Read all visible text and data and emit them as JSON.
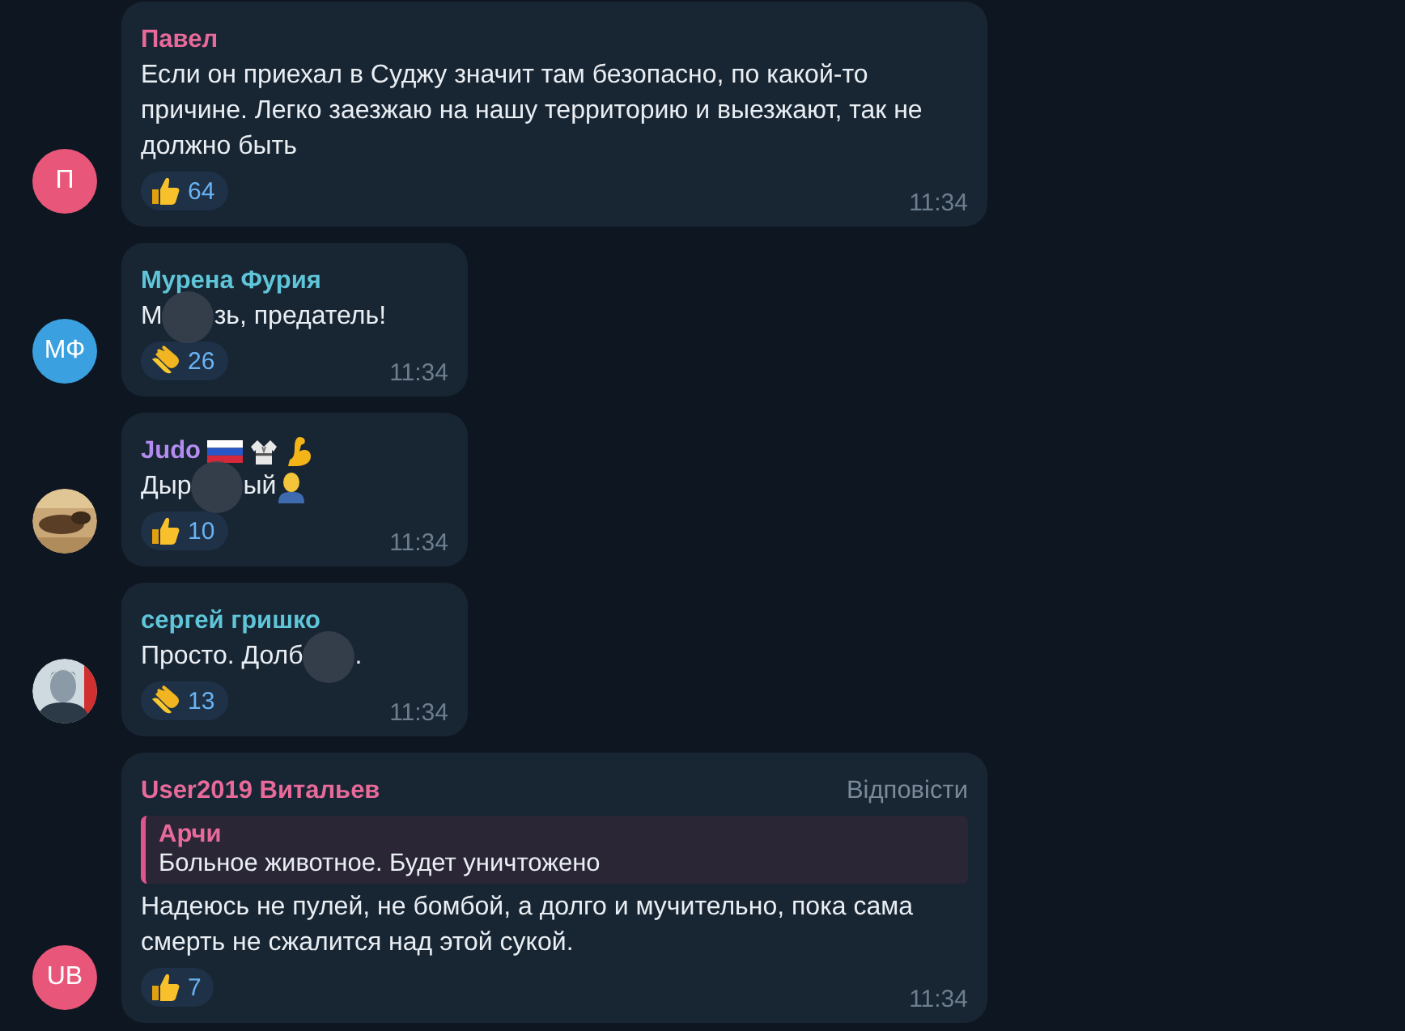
{
  "messages": [
    {
      "author": {
        "name": "Павел",
        "color": "#e86a9a"
      },
      "avatar": {
        "kind": "initials",
        "initials": "П",
        "color": "#e8577a"
      },
      "text": [
        {
          "kind": "text",
          "text": "Если он приехал в Суджу значит там безопасно, по какой-то причине. Легко заезжаю на нашу территорию и выезжают, так не должно быть"
        }
      ],
      "reaction": {
        "kind": "thumbs_up",
        "count": "64"
      },
      "time": "11:34"
    },
    {
      "author": {
        "name": "Мурена Фурия",
        "color": "#5fc5d8"
      },
      "avatar": {
        "kind": "initials",
        "initials": "МФ",
        "color": "#3aa0e0"
      },
      "text": [
        {
          "kind": "text",
          "text": "М"
        },
        {
          "kind": "blur"
        },
        {
          "kind": "text",
          "text": "зь, предатель!"
        }
      ],
      "reaction": {
        "kind": "clap",
        "count": "26"
      },
      "time": "11:34"
    },
    {
      "author": {
        "name": "Judo",
        "color": "#b48cf0",
        "icons": [
          {
            "kind": "flag"
          },
          {
            "kind": "kimono"
          },
          {
            "kind": "muscle"
          }
        ]
      },
      "avatar": {
        "kind": "picture"
      },
      "text": [
        {
          "kind": "text",
          "text": "Дыр"
        },
        {
          "kind": "blur"
        },
        {
          "kind": "text",
          "text": "ый"
        },
        {
          "kind": "bald"
        }
      ],
      "reaction": {
        "kind": "thumbs_up",
        "count": "10"
      },
      "time": "11:34"
    },
    {
      "author": {
        "name": "сергей гришко",
        "color": "#5fc5d8"
      },
      "avatar": {
        "kind": "picture"
      },
      "text": [
        {
          "kind": "text",
          "text": "Просто. Долб"
        },
        {
          "kind": "blur"
        },
        {
          "kind": "text",
          "text": "."
        }
      ],
      "reaction": {
        "kind": "clap",
        "count": "13"
      },
      "time": "11:34"
    },
    {
      "author": {
        "name": "User2019 Витальев",
        "color": "#e86a9a"
      },
      "reply_button": "Відповісти",
      "quote": {
        "author": "Арчи",
        "text": "Больное животное. Будет уничтожено"
      },
      "avatar": {
        "kind": "initials",
        "initials": "UB",
        "color": "#e8577a"
      },
      "text": [
        {
          "kind": "text",
          "text": "Надеюсь не пулей, не бомбой, а долго и мучительно, пока сама смерть не сжалится над этой сукой."
        }
      ],
      "reaction": {
        "kind": "thumbs_up",
        "count": "7"
      },
      "time": "11:34"
    }
  ]
}
